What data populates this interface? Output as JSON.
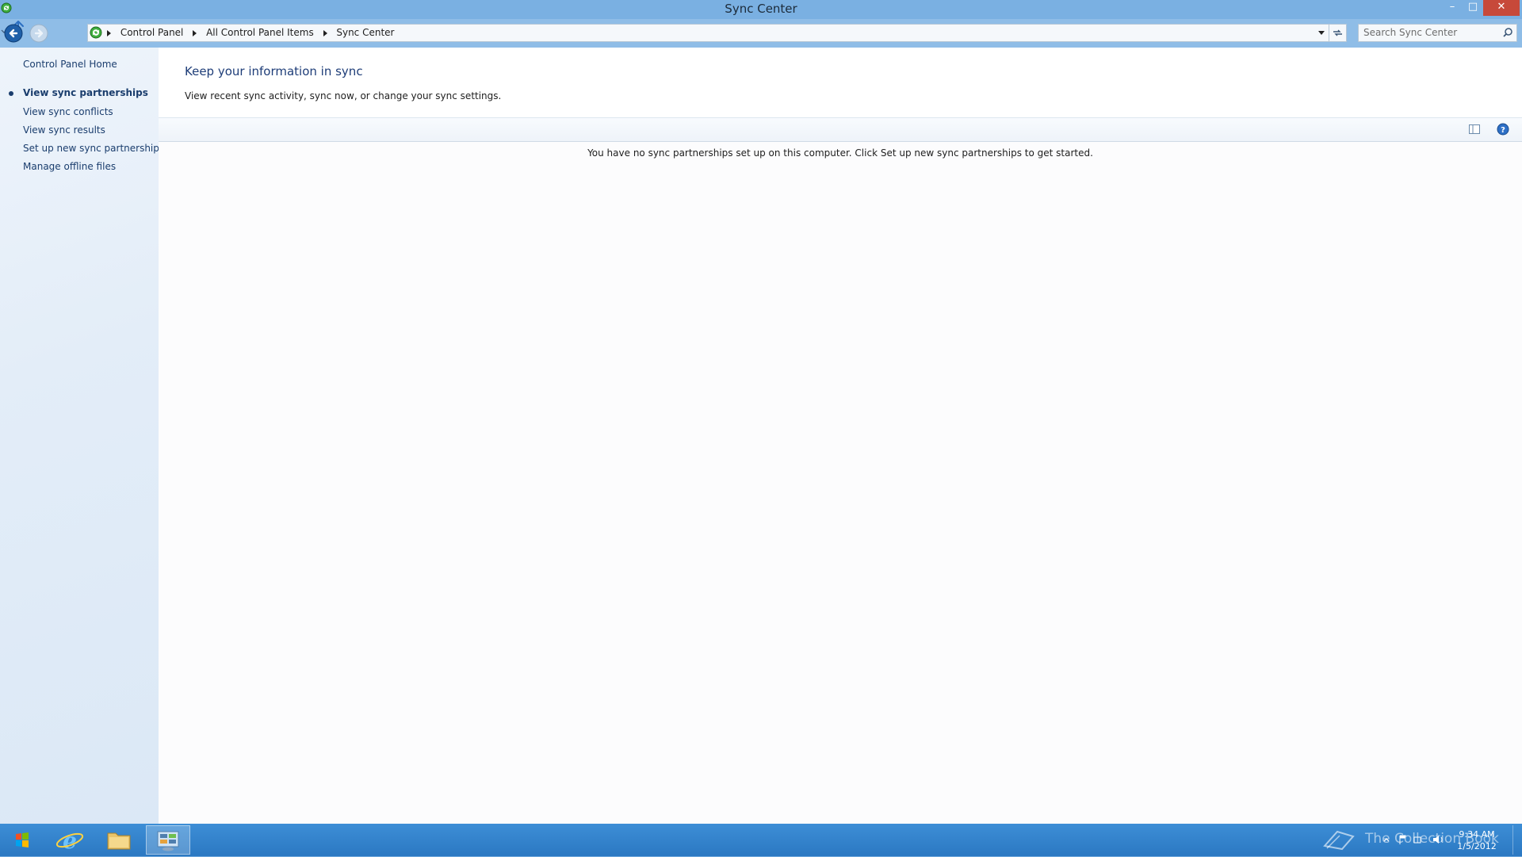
{
  "window": {
    "title": "Sync Center",
    "minimize_glyph": "–",
    "maximize_glyph": "□",
    "close_glyph": "✕"
  },
  "address_bar": {
    "breadcrumbs": [
      "Control Panel",
      "All Control Panel Items",
      "Sync Center"
    ]
  },
  "search": {
    "placeholder": "Search Sync Center"
  },
  "left_pane": {
    "home": "Control Panel Home",
    "links": [
      "View sync partnerships",
      "View sync conflicts",
      "View sync results",
      "Set up new sync partnerships",
      "Manage offline files"
    ]
  },
  "main": {
    "heading": "Keep your information in sync",
    "subtext": "View recent sync activity, sync now, or change your sync settings.",
    "empty_message": "You have no sync partnerships set up on this computer. Click Set up new sync partnerships to get started."
  },
  "taskbar": {
    "time": "9:34 AM",
    "date": "1/5/2012",
    "watermark": "The Collection Book"
  },
  "colors": {
    "title_bar": "#7ab0e2",
    "taskbar": "#2b78c2",
    "link": "#1a3d6d",
    "heading": "#1e3d78"
  }
}
